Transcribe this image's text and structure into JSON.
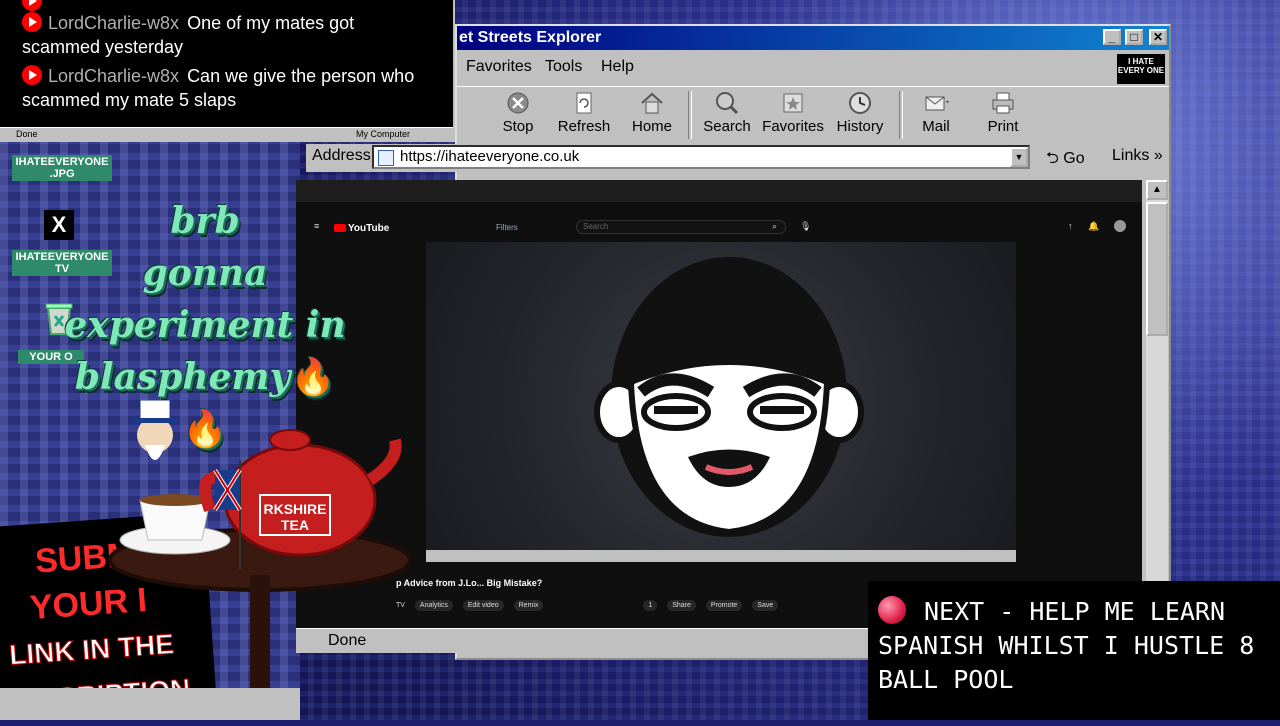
{
  "chat": {
    "messages": [
      {
        "user": "LordCharlie-w8x",
        "text": "One of my mates got scammed yesterday"
      },
      {
        "user": "LordCharlie-w8x",
        "text": "Can we give the person who scammed my mate 5 slaps"
      }
    ],
    "status_left": "Done",
    "status_right": "My Computer"
  },
  "browser": {
    "title": "et Streets Explorer",
    "menu": [
      "Favorites",
      "Tools",
      "Help"
    ],
    "logo_text": "I HATE EVERY ONE",
    "toolbar": [
      {
        "label": "Stop",
        "icon": "stop-icon"
      },
      {
        "label": "Refresh",
        "icon": "refresh-icon"
      },
      {
        "label": "Home",
        "icon": "home-icon"
      },
      {
        "label": "Search",
        "icon": "search-icon"
      },
      {
        "label": "Favorites",
        "icon": "favorites-icon"
      },
      {
        "label": "History",
        "icon": "history-icon"
      },
      {
        "label": "Mail",
        "icon": "mail-icon"
      },
      {
        "label": "Print",
        "icon": "print-icon"
      }
    ],
    "address_label": "Address",
    "url": "https://ihateeveryone.co.uk",
    "go_label": "Go",
    "links_label": "Links",
    "status": "Done"
  },
  "youtube": {
    "logo": "YouTube",
    "filters": "Filters",
    "search_placeholder": "Search",
    "video_title": "p Advice from J.Lo... Big Mistake?",
    "channel": "TV",
    "actions": [
      "Analytics",
      "Edit video",
      "Remix",
      "1",
      "Share",
      "Promote",
      "Save"
    ]
  },
  "desktop": {
    "icons": [
      {
        "label": "IHATEEVERYONE .JPG"
      },
      {
        "label": "IHATEEVERYONE TV"
      },
      {
        "label": "YOUR O"
      }
    ],
    "brb_text": [
      "brb",
      "gonna",
      "experiment in",
      "blasphemy"
    ],
    "brb_emoji": "🔥🔥",
    "submit_text": [
      "SUBM",
      "YOUR I",
      "LINK IN THE",
      "DESCRIPTION"
    ]
  },
  "next_banner": {
    "text": "NEXT - HELP ME LEARN SPANISH WHILST I HUSTLE 8 BALL POOL"
  }
}
